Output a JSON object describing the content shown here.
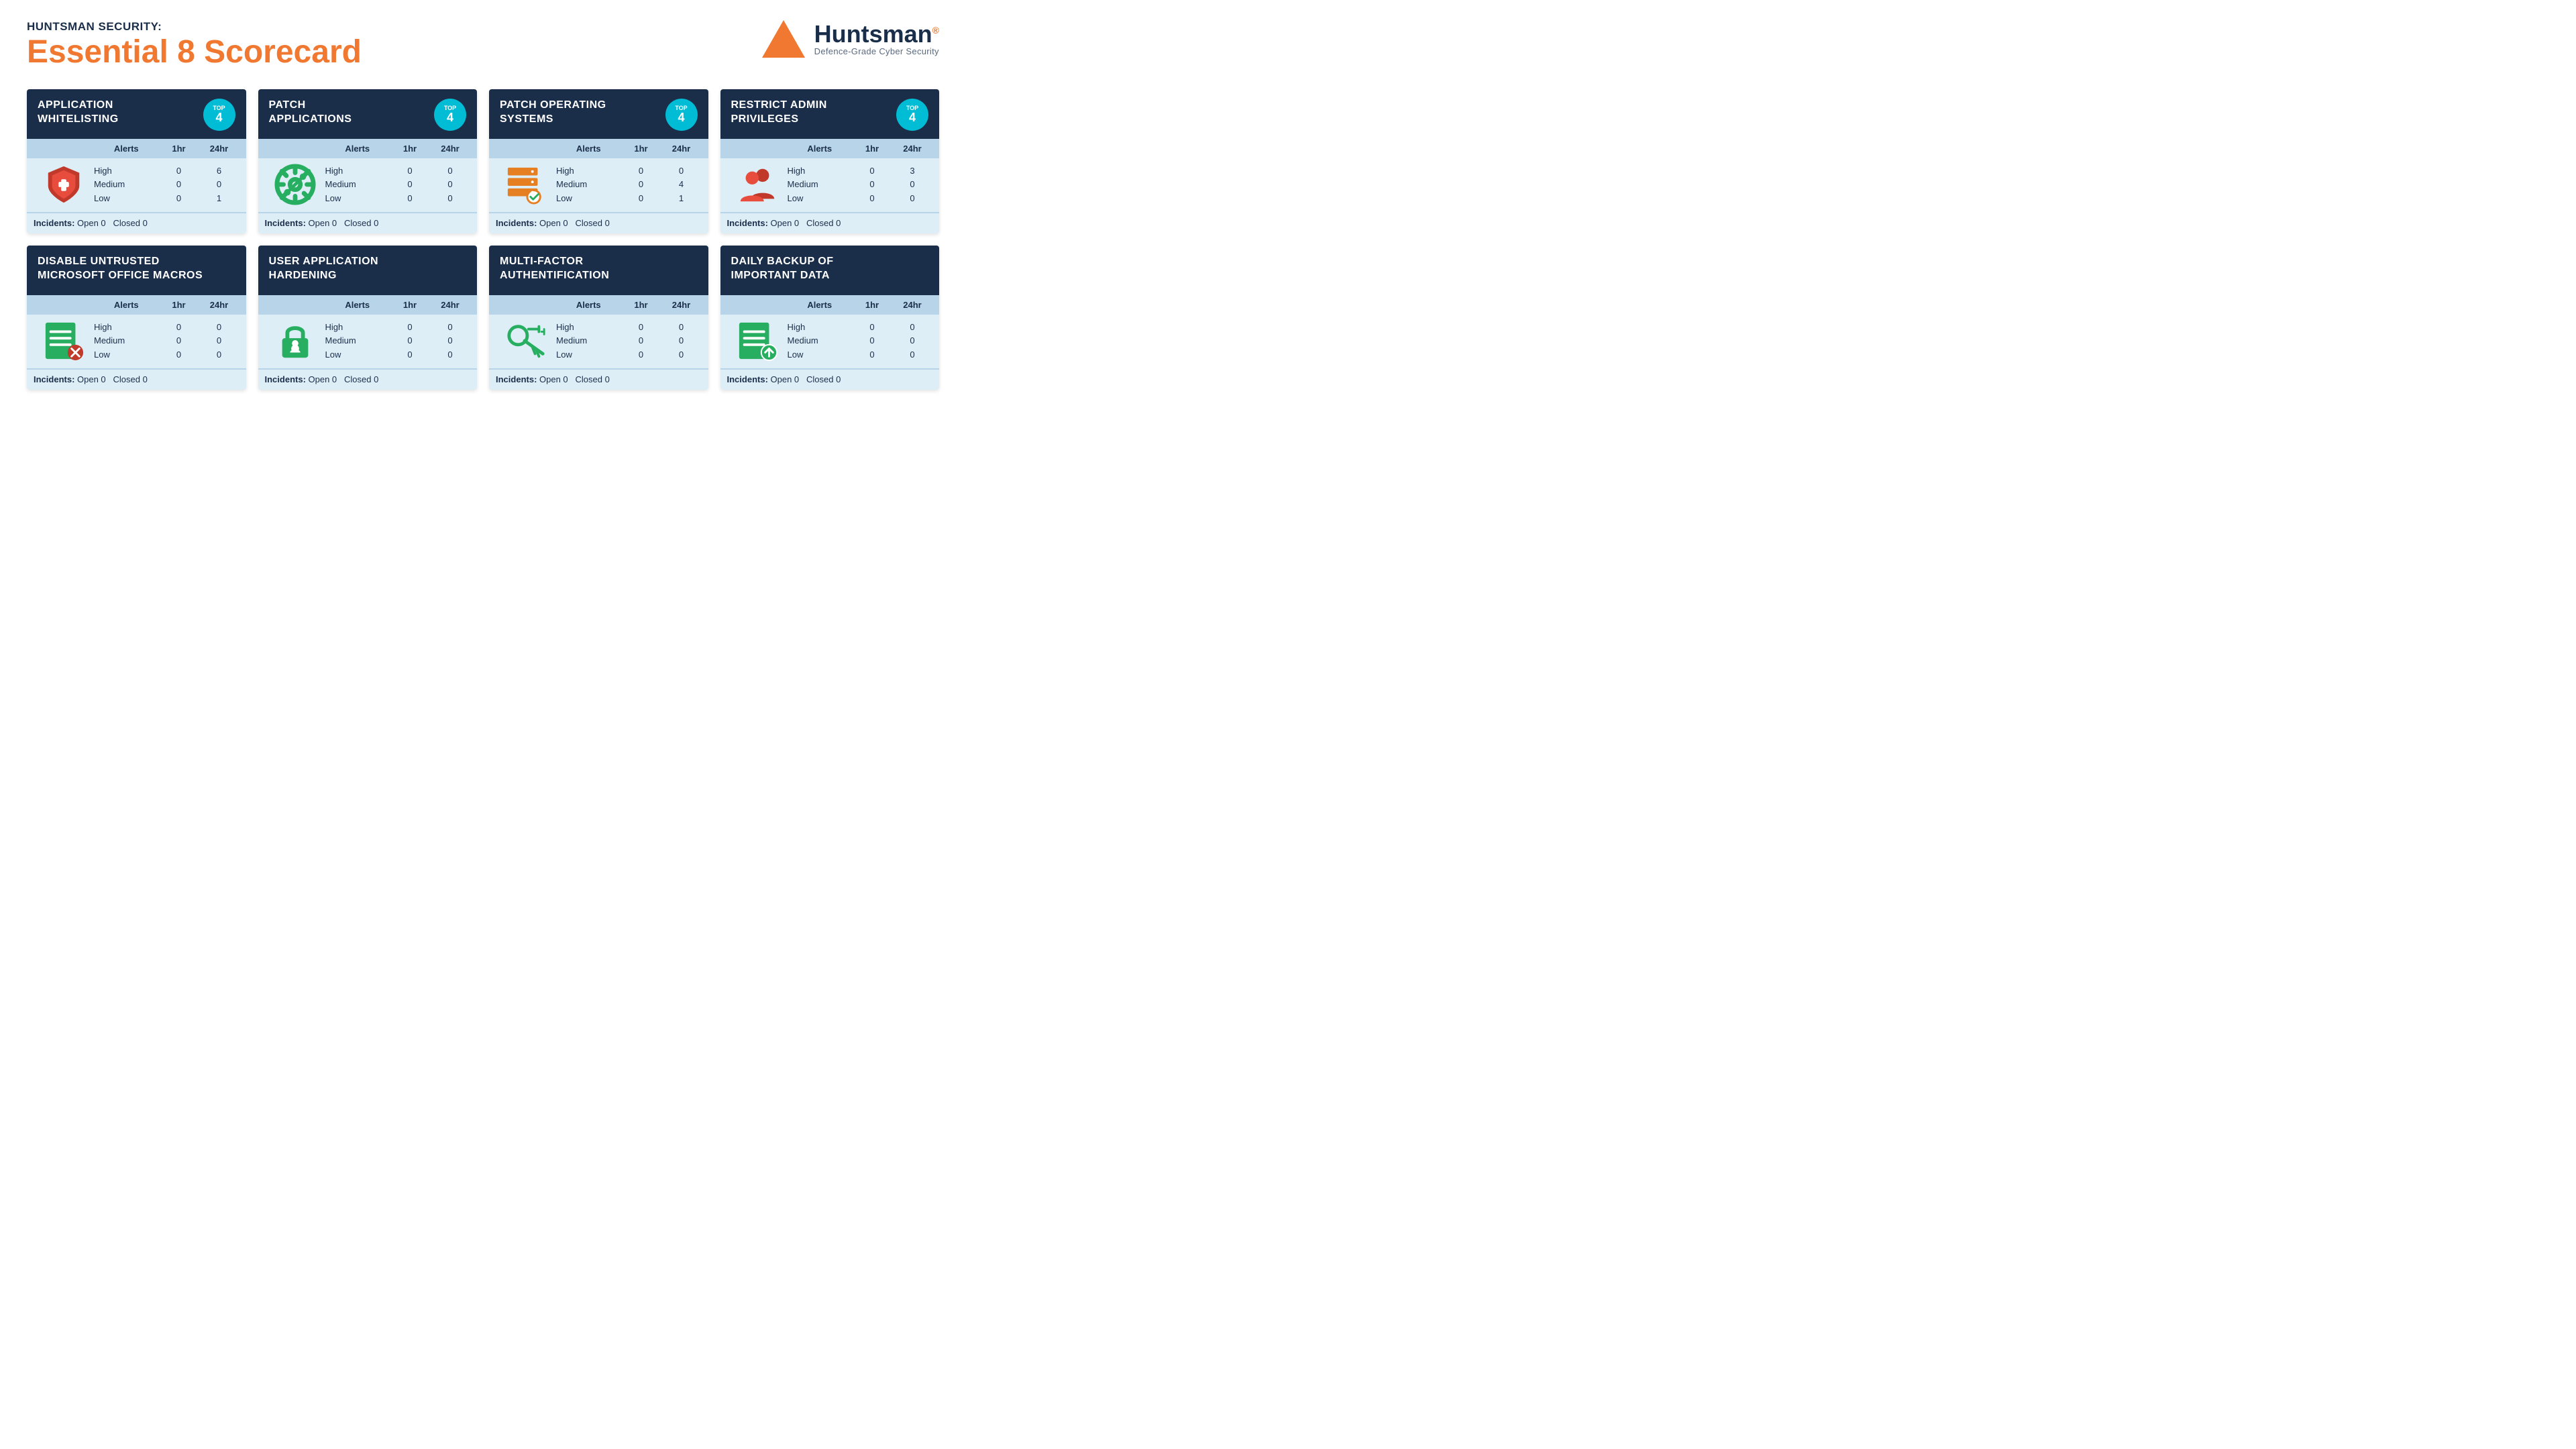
{
  "header": {
    "subtitle": "HUNTSMAN SECURITY:",
    "title": "Essential 8 Scorecard",
    "logo_brand": "Huntsman",
    "logo_tagline": "Defence-Grade Cyber Security"
  },
  "cards": [
    {
      "id": "app-whitelisting",
      "title": "APPLICATION\nWHITELISTING",
      "top": "4",
      "has_top_badge": true,
      "icon_type": "shield-red",
      "rows": [
        {
          "level": "High",
          "hr": "0",
          "h24": "6"
        },
        {
          "level": "Medium",
          "hr": "0",
          "h24": "0"
        },
        {
          "level": "Low",
          "hr": "0",
          "h24": "1"
        }
      ],
      "incidents_open": "0",
      "incidents_closed": "0"
    },
    {
      "id": "patch-applications",
      "title": "PATCH\nAPPLICATIONS",
      "top": "4",
      "has_top_badge": true,
      "icon_type": "gear-green",
      "rows": [
        {
          "level": "High",
          "hr": "0",
          "h24": "0"
        },
        {
          "level": "Medium",
          "hr": "0",
          "h24": "0"
        },
        {
          "level": "Low",
          "hr": "0",
          "h24": "0"
        }
      ],
      "incidents_open": "0",
      "incidents_closed": "0"
    },
    {
      "id": "patch-os",
      "title": "PATCH OPERATING\nSYSTEMS",
      "top": "4",
      "has_top_badge": true,
      "icon_type": "server-orange",
      "rows": [
        {
          "level": "High",
          "hr": "0",
          "h24": "0"
        },
        {
          "level": "Medium",
          "hr": "0",
          "h24": "4"
        },
        {
          "level": "Low",
          "hr": "0",
          "h24": "1"
        }
      ],
      "incidents_open": "0",
      "incidents_closed": "0"
    },
    {
      "id": "restrict-admin",
      "title": "RESTRICT ADMIN\nPRIVILEGES",
      "top": "4",
      "has_top_badge": true,
      "icon_type": "users-red",
      "rows": [
        {
          "level": "High",
          "hr": "0",
          "h24": "3"
        },
        {
          "level": "Medium",
          "hr": "0",
          "h24": "0"
        },
        {
          "level": "Low",
          "hr": "0",
          "h24": "0"
        }
      ],
      "incidents_open": "0",
      "incidents_closed": "0"
    },
    {
      "id": "disable-macros",
      "title": "DISABLE UNTRUSTED\nMICROSOFT OFFICE MACROS",
      "top": null,
      "has_top_badge": false,
      "icon_type": "doc-x-green",
      "rows": [
        {
          "level": "High",
          "hr": "0",
          "h24": "0"
        },
        {
          "level": "Medium",
          "hr": "0",
          "h24": "0"
        },
        {
          "level": "Low",
          "hr": "0",
          "h24": "0"
        }
      ],
      "incidents_open": "0",
      "incidents_closed": "0"
    },
    {
      "id": "user-app-hardening",
      "title": "USER APPLICATION\nHARDENING",
      "top": null,
      "has_top_badge": false,
      "icon_type": "lock-green",
      "rows": [
        {
          "level": "High",
          "hr": "0",
          "h24": "0"
        },
        {
          "level": "Medium",
          "hr": "0",
          "h24": "0"
        },
        {
          "level": "Low",
          "hr": "0",
          "h24": "0"
        }
      ],
      "incidents_open": "0",
      "incidents_closed": "0"
    },
    {
      "id": "mfa",
      "title": "MULTI-FACTOR\nAUTHENTIFICATION",
      "top": null,
      "has_top_badge": false,
      "icon_type": "key-green",
      "rows": [
        {
          "level": "High",
          "hr": "0",
          "h24": "0"
        },
        {
          "level": "Medium",
          "hr": "0",
          "h24": "0"
        },
        {
          "level": "Low",
          "hr": "0",
          "h24": "0"
        }
      ],
      "incidents_open": "0",
      "incidents_closed": "0"
    },
    {
      "id": "daily-backup",
      "title": "DAILY BACKUP OF\nIMPORTANT DATA",
      "top": null,
      "has_top_badge": false,
      "icon_type": "doc-up-green",
      "rows": [
        {
          "level": "High",
          "hr": "0",
          "h24": "0"
        },
        {
          "level": "Medium",
          "hr": "0",
          "h24": "0"
        },
        {
          "level": "Low",
          "hr": "0",
          "h24": "0"
        }
      ],
      "incidents_open": "0",
      "incidents_closed": "0"
    }
  ],
  "table_headers": {
    "alerts": "Alerts",
    "hr": "1hr",
    "h24": "24hr"
  },
  "incidents_label": "Incidents:",
  "open_label": "Open",
  "closed_label": "Closed"
}
